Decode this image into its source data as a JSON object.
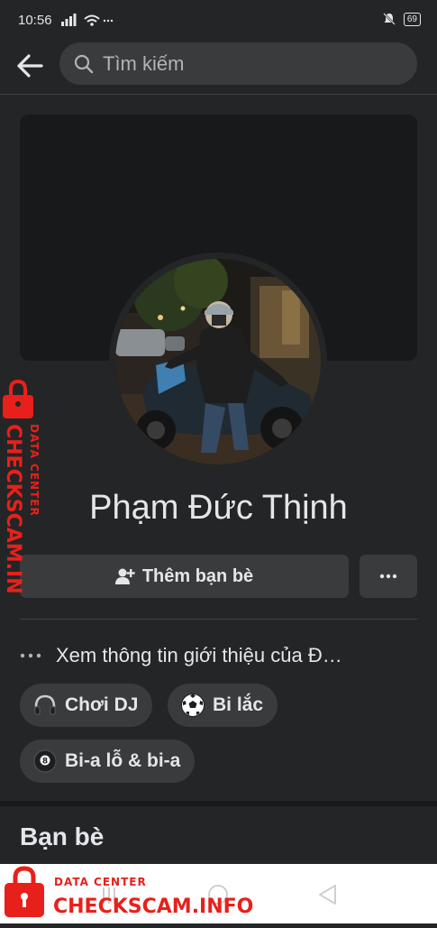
{
  "status_bar": {
    "time": "10:56",
    "battery": "69"
  },
  "search": {
    "placeholder": "Tìm kiếm"
  },
  "profile": {
    "name": "Phạm Đức Thịnh",
    "add_friend_label": "Thêm bạn bè",
    "intro_text": "Xem thông tin giới thiệu của Đ…"
  },
  "interests": [
    {
      "icon": "headphones-icon",
      "label": "Chơi DJ"
    },
    {
      "icon": "soccer-ball-icon",
      "label": "Bi lắc"
    },
    {
      "icon": "billiard-8-ball-icon",
      "label": "Bi-a lỗ & bi-a"
    }
  ],
  "sections": {
    "friends_title": "Bạn bè"
  },
  "watermark": {
    "small": "DATA CENTER",
    "big": "CHECKSCAM.INFO"
  },
  "colors": {
    "background": "#242526",
    "surface": "#3a3b3c",
    "text": "#e4e6eb",
    "watermark": "#e8201b"
  }
}
